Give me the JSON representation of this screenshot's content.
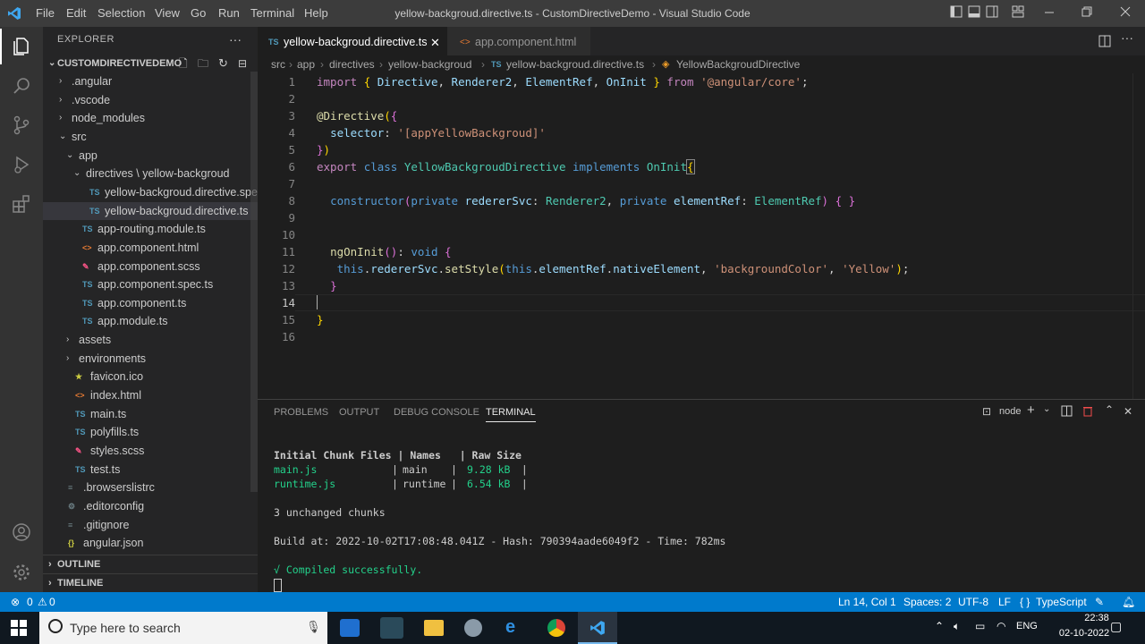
{
  "titlebar": {
    "menu": [
      "File",
      "Edit",
      "Selection",
      "View",
      "Go",
      "Run",
      "Terminal",
      "Help"
    ],
    "title": "yellow-backgroud.directive.ts - CustomDirectiveDemo - Visual Studio Code"
  },
  "sidebar": {
    "header": "EXPLORER",
    "project": "CUSTOMDIRECTIVEDEMO",
    "tree": [
      {
        "label": ".angular",
        "type": "folder",
        "open": false
      },
      {
        "label": ".vscode",
        "type": "folder",
        "open": false
      },
      {
        "label": "node_modules",
        "type": "folder",
        "open": false
      },
      {
        "label": "src",
        "type": "folder",
        "open": true
      },
      {
        "label": "app",
        "type": "folder",
        "open": true
      },
      {
        "label": "directives \\ yellow-backgroud",
        "type": "folder",
        "open": true
      },
      {
        "label": "yellow-backgroud.directive.spec.ts",
        "type": "ts"
      },
      {
        "label": "yellow-backgroud.directive.ts",
        "type": "ts",
        "selected": true
      },
      {
        "label": "app-routing.module.ts",
        "type": "ts"
      },
      {
        "label": "app.component.html",
        "type": "html"
      },
      {
        "label": "app.component.scss",
        "type": "scss"
      },
      {
        "label": "app.component.spec.ts",
        "type": "ts"
      },
      {
        "label": "app.component.ts",
        "type": "ts"
      },
      {
        "label": "app.module.ts",
        "type": "ts"
      },
      {
        "label": "assets",
        "type": "folder",
        "open": false
      },
      {
        "label": "environments",
        "type": "folder",
        "open": false
      },
      {
        "label": "favicon.ico",
        "type": "star"
      },
      {
        "label": "index.html",
        "type": "html"
      },
      {
        "label": "main.ts",
        "type": "ts"
      },
      {
        "label": "polyfills.ts",
        "type": "ts"
      },
      {
        "label": "styles.scss",
        "type": "scss"
      },
      {
        "label": "test.ts",
        "type": "ts"
      },
      {
        "label": ".browserslistrc",
        "type": "text"
      },
      {
        "label": ".editorconfig",
        "type": "gear"
      },
      {
        "label": ".gitignore",
        "type": "text"
      },
      {
        "label": "angular.json",
        "type": "json"
      }
    ],
    "outline": "OUTLINE",
    "timeline": "TIMELINE"
  },
  "tabs": [
    {
      "label": "yellow-backgroud.directive.ts",
      "active": true
    },
    {
      "label": "app.component.html",
      "active": false
    }
  ],
  "breadcrumb": [
    "src",
    "app",
    "directives",
    "yellow-backgroud",
    "yellow-backgroud.directive.ts",
    "YellowBackgroudDirective"
  ],
  "code": {
    "line_numbers": [
      "1",
      "2",
      "3",
      "4",
      "5",
      "6",
      "7",
      "8",
      "9",
      "10",
      "11",
      "12",
      "13",
      "14",
      "15",
      "16"
    ]
  },
  "panel": {
    "tabs": [
      "PROBLEMS",
      "OUTPUT",
      "DEBUG CONSOLE",
      "TERMINAL"
    ],
    "active_tab": "TERMINAL",
    "shell": "node",
    "terminal": {
      "header": "Initial Chunk Files | Names   | Raw Size",
      "rows": [
        {
          "file": "main.js",
          "name": "main",
          "size": "9.28 kB"
        },
        {
          "file": "runtime.js",
          "name": "runtime",
          "size": "6.54 kB"
        }
      ],
      "unchanged": "3 unchanged chunks",
      "build": "Build at: 2022-10-02T17:08:48.041Z - Hash: 790394aade6049f2 - Time: 782ms",
      "compiled": "√ Compiled successfully."
    }
  },
  "status": {
    "problems": "0",
    "warnings": "0",
    "position": "Ln 14, Col 1",
    "spaces": "Spaces: 2",
    "encoding": "UTF-8",
    "eol": "LF",
    "language": "TypeScript"
  },
  "taskbar": {
    "search_placeholder": "Type here to search",
    "lang": "ENG",
    "time": "22:38",
    "date": "02-10-2022"
  },
  "colors": {
    "accent": "#007acc",
    "titlebar": "#3c3c3c",
    "sidebar": "#252526",
    "editor": "#1e1e1e"
  }
}
